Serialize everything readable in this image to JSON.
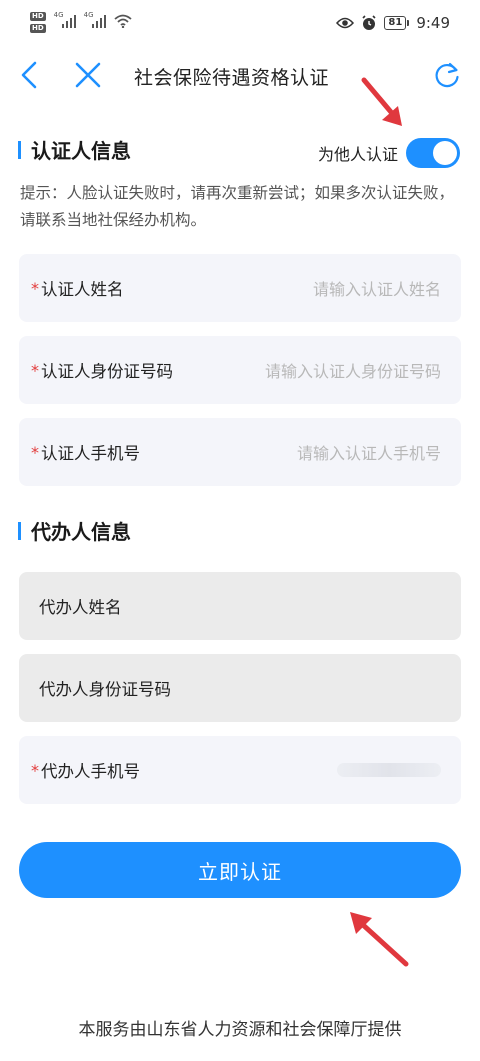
{
  "status_bar": {
    "sim1_label": "HD",
    "sim2_label": "HD",
    "net1": "4G",
    "net2": "4G",
    "battery": "81",
    "time": "9:49"
  },
  "nav": {
    "title": "社会保险待遇资格认证",
    "icons": [
      "back-icon",
      "close-icon",
      "refresh-icon"
    ]
  },
  "certifier_section": {
    "title": "认证人信息",
    "toggle_label": "为他人认证",
    "toggle_on": true,
    "hint": "提示：人脸认证失败时，请再次重新尝试；如果多次认证失败，请联系当地社保经办机构。",
    "fields": [
      {
        "required_mark": "*",
        "label": "认证人姓名",
        "placeholder": "请输入认证人姓名"
      },
      {
        "required_mark": "*",
        "label": "认证人身份证号码",
        "placeholder": "请输入认证人身份证号码"
      },
      {
        "required_mark": "*",
        "label": "认证人手机号",
        "placeholder": "请输入认证人手机号"
      }
    ]
  },
  "agent_section": {
    "title": "代办人信息",
    "fields": [
      {
        "label": "代办人姓名"
      },
      {
        "label": "代办人身份证号码"
      },
      {
        "required_mark": "*",
        "label": "代办人手机号"
      }
    ]
  },
  "submit_label": "立即认证",
  "footer": "本服务由山东省人力资源和社会保障厅提供",
  "colors": {
    "accent": "#1e90ff",
    "required": "#e23b3b",
    "annotation": "#e0383e"
  }
}
